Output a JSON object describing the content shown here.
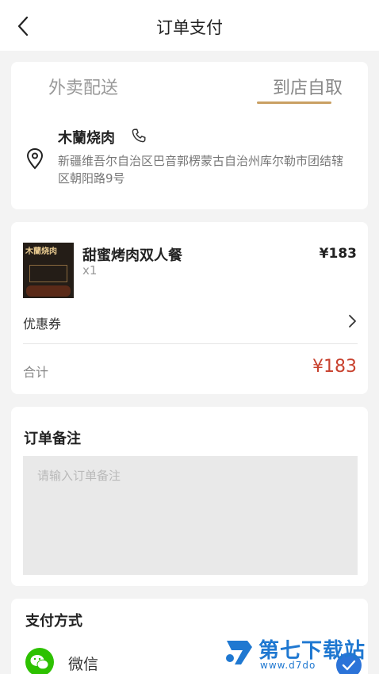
{
  "header": {
    "title": "订单支付"
  },
  "tabs": {
    "delivery": "外卖配送",
    "pickup": "到店自取",
    "active": "pickup"
  },
  "store": {
    "name": "木蘭烧肉",
    "address": "新疆维吾尔自治区巴音郭楞蒙古自治州库尔勒市团结辖区朝阳路9号"
  },
  "order": {
    "item_name": "甜蜜烤肉双人餐",
    "item_qty": "x1",
    "item_price": "¥183",
    "image_text": "木蘭烧肉",
    "coupon_label": "优惠券",
    "total_label": "合计",
    "total_price": "¥183"
  },
  "remark": {
    "title": "订单备注",
    "placeholder": "请输入订单备注",
    "value": ""
  },
  "payment": {
    "title": "支付方式",
    "wechat_label": "微信"
  },
  "watermark": {
    "title": "第七下载站",
    "url": "www.d7do"
  },
  "colors": {
    "accent": "#c9a063",
    "price": "#c8412e",
    "wechat": "#2dc100",
    "watermark": "#1f78d1"
  }
}
